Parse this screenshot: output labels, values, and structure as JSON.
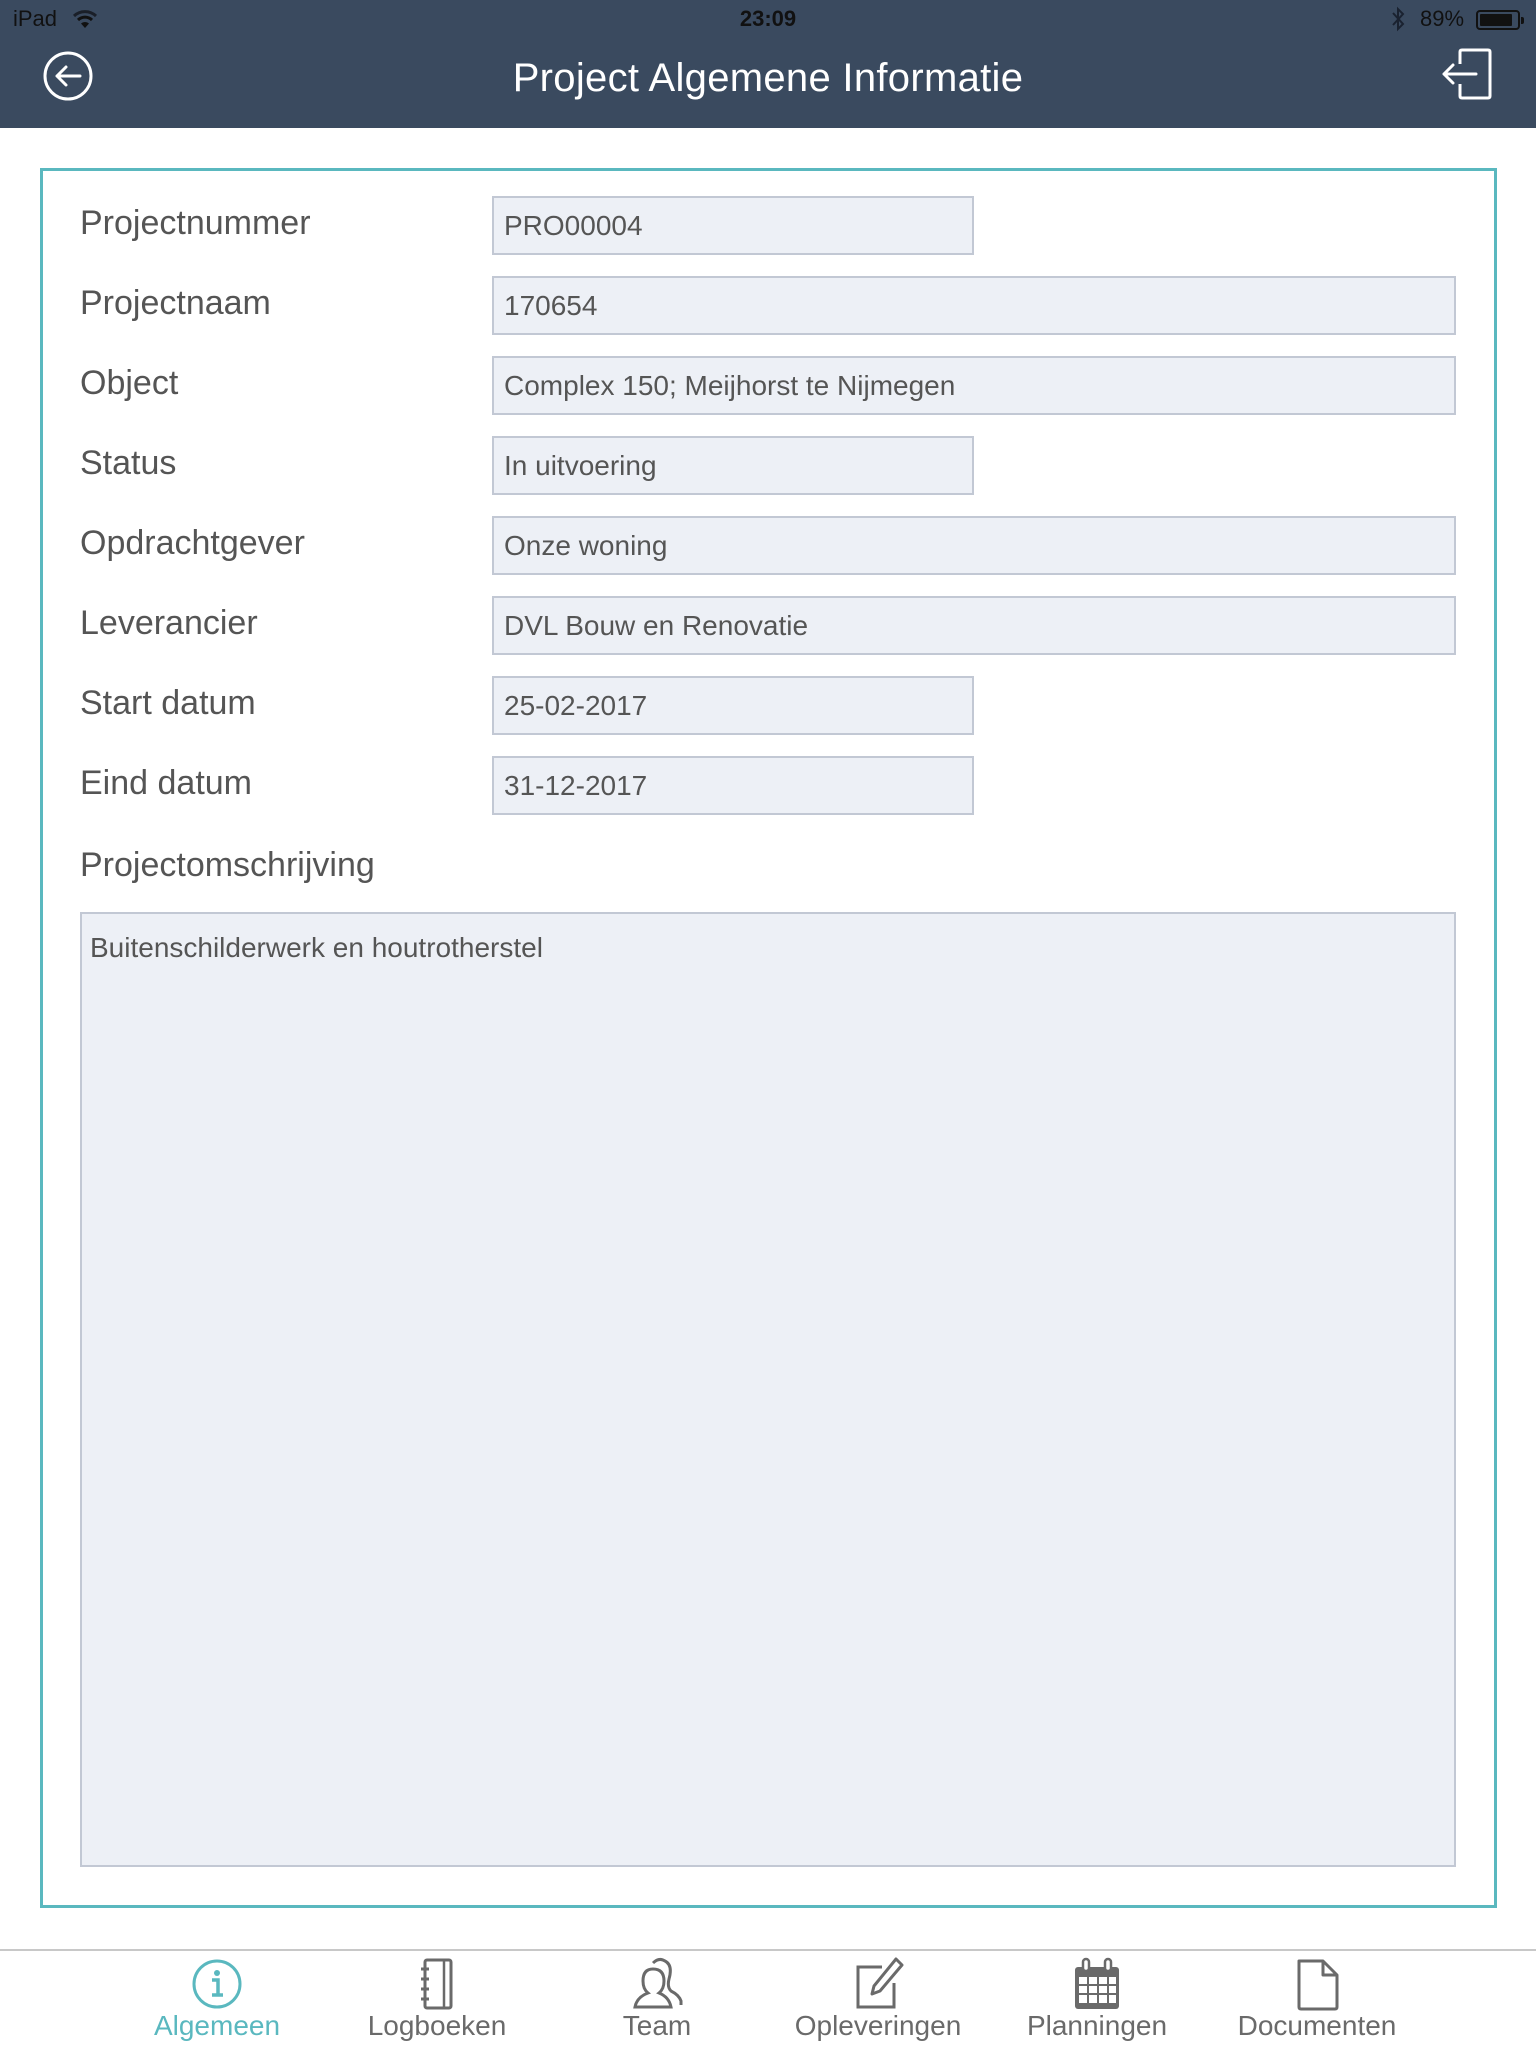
{
  "status_bar": {
    "device": "iPad",
    "time": "23:09",
    "battery_percent_label": "89%",
    "battery_level": 0.89,
    "icons": [
      "wifi-icon",
      "bluetooth-icon",
      "battery-icon"
    ]
  },
  "header": {
    "title": "Project Algemene Informatie",
    "back_icon": "circle-arrow-left-icon",
    "logout_icon": "logout-icon"
  },
  "colors": {
    "header_bg": "#3a4a5f",
    "accent": "#5ab8bf",
    "field_bg": "#edf0f6",
    "field_border": "#c2c8d4"
  },
  "form": {
    "fields": [
      {
        "label": "Projectnummer",
        "value": "PRO00004"
      },
      {
        "label": "Projectnaam",
        "value": "170654"
      },
      {
        "label": "Object",
        "value": "Complex 150; Meijhorst te Nijmegen"
      },
      {
        "label": "Status",
        "value": "In uitvoering"
      },
      {
        "label": "Opdrachtgever",
        "value": "Onze woning"
      },
      {
        "label": "Leverancier",
        "value": "DVL Bouw en Renovatie"
      },
      {
        "label": "Start datum",
        "value": "25-02-2017"
      },
      {
        "label": "Eind datum",
        "value": "31-12-2017"
      }
    ],
    "description": {
      "label": "Projectomschrijving",
      "value": "Buitenschilderwerk en houtrotherstel"
    }
  },
  "tabbar": {
    "active": "Algemeen",
    "tabs": [
      {
        "label": "Algemeen",
        "icon": "info-icon"
      },
      {
        "label": "Logboeken",
        "icon": "notebook-icon"
      },
      {
        "label": "Team",
        "icon": "team-icon"
      },
      {
        "label": "Opleveringen",
        "icon": "edit-icon"
      },
      {
        "label": "Planningen",
        "icon": "calendar-icon"
      },
      {
        "label": "Documenten",
        "icon": "document-icon"
      }
    ]
  }
}
